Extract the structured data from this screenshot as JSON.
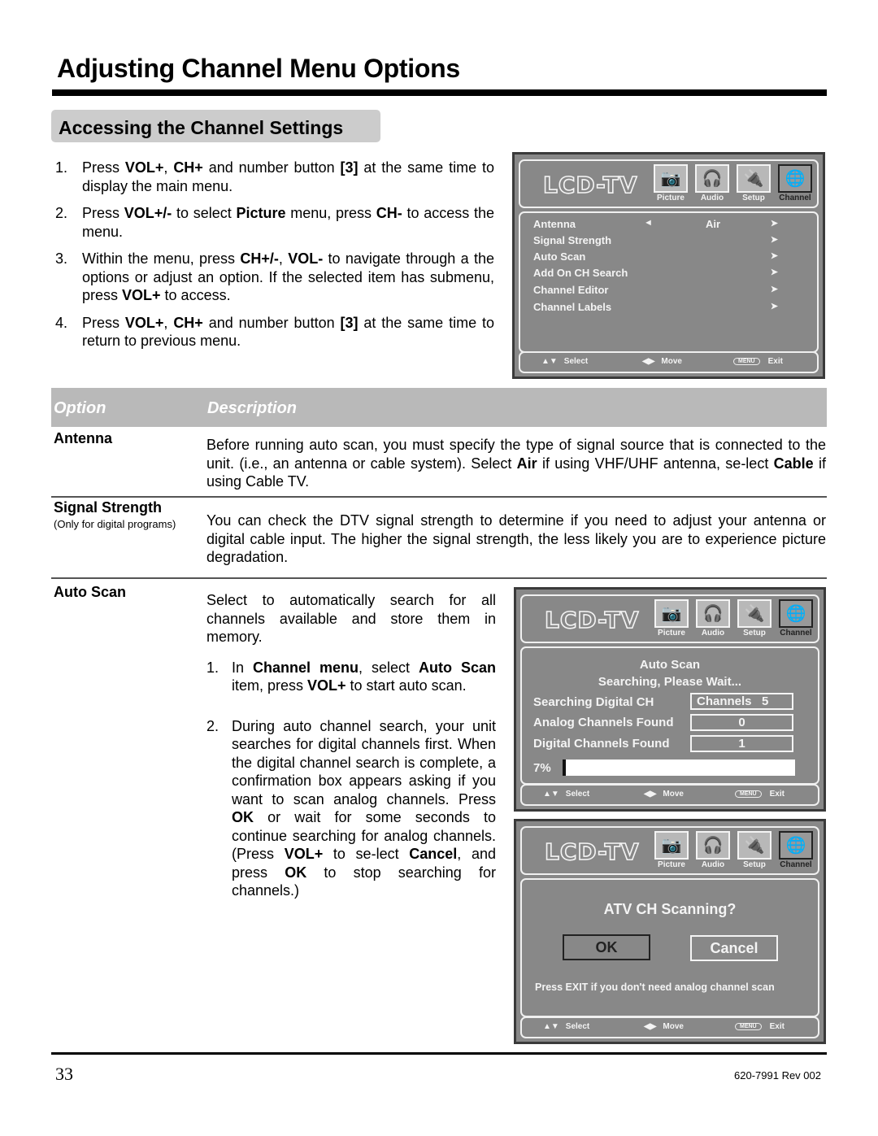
{
  "page": {
    "title": "Adjusting Channel Menu Options",
    "section_title": "Accessing the Channel Settings",
    "page_number": "33",
    "doc_id": "620-7991 Rev 002"
  },
  "steps": [
    {
      "num": "1.",
      "parts": [
        [
          "Press ",
          false
        ],
        [
          "VOL+",
          true
        ],
        [
          ", ",
          false
        ],
        [
          "CH+",
          true
        ],
        [
          " and number button ",
          false
        ],
        [
          "[3]",
          true
        ],
        [
          " at the same time to display the main menu.",
          false
        ]
      ]
    },
    {
      "num": "2.",
      "parts": [
        [
          "Press ",
          false
        ],
        [
          "VOL+/-",
          true
        ],
        [
          " to select ",
          false
        ],
        [
          "Picture",
          true
        ],
        [
          " menu, press ",
          false
        ],
        [
          "CH-",
          true
        ],
        [
          " to access the menu.",
          false
        ]
      ]
    },
    {
      "num": "3.",
      "parts": [
        [
          "Within the menu, press ",
          false
        ],
        [
          "CH+/-",
          true
        ],
        [
          ", ",
          false
        ],
        [
          "VOL-",
          true
        ],
        [
          " to navigate through a the options or adjust an option. If the selected item has submenu, press ",
          false
        ],
        [
          "VOL+",
          true
        ],
        [
          " to access.",
          false
        ]
      ]
    },
    {
      "num": "4.",
      "parts": [
        [
          "Press ",
          false
        ],
        [
          "VOL+",
          true
        ],
        [
          ", ",
          false
        ],
        [
          "CH+",
          true
        ],
        [
          " and number button ",
          false
        ],
        [
          "[3]",
          true
        ],
        [
          " at the same time to return  to previous menu.",
          false
        ]
      ]
    }
  ],
  "osd_common": {
    "logo": "LCD-TV",
    "tabs": [
      {
        "label": "Picture",
        "icon": "camera-icon",
        "glyph": "📷",
        "active": false
      },
      {
        "label": "Audio",
        "icon": "headphones-icon",
        "glyph": "🎧",
        "active": false
      },
      {
        "label": "Setup",
        "icon": "connector-icon",
        "glyph": "🔌",
        "active": false
      },
      {
        "label": "Channel",
        "icon": "globe-icon",
        "glyph": "🌐",
        "active": true
      }
    ],
    "footer": {
      "select_glyph": "▲▼",
      "select_label": "Select",
      "move_glyph": "◀▶",
      "move_label": "Move",
      "menu_key": "MENU",
      "exit_label": "Exit"
    }
  },
  "osd_channel_menu": {
    "items": [
      {
        "label": "Antenna",
        "left_arrow": "◄",
        "value": "Air",
        "right_arrow": "➤"
      },
      {
        "label": "Signal Strength",
        "left_arrow": "",
        "value": "",
        "right_arrow": "➤"
      },
      {
        "label": "Auto Scan",
        "left_arrow": "",
        "value": "",
        "right_arrow": "➤"
      },
      {
        "label": "Add On CH Search",
        "left_arrow": "",
        "value": "",
        "right_arrow": "➤"
      },
      {
        "label": "Channel Editor",
        "left_arrow": "",
        "value": "",
        "right_arrow": "➤"
      },
      {
        "label": "Channel Labels",
        "left_arrow": "",
        "value": "",
        "right_arrow": "➤"
      }
    ]
  },
  "osd_auto_scan": {
    "title": "Auto Scan",
    "subtitle": "Searching, Please Wait...",
    "rows": [
      {
        "label": "Searching Digital CH",
        "value": "Channels   5"
      },
      {
        "label": "Analog Channels Found",
        "value": "0"
      },
      {
        "label": "Digital Channels Found",
        "value": "1"
      }
    ],
    "progress_label": "7%",
    "progress": 0.07
  },
  "osd_atv": {
    "question": "ATV CH Scanning?",
    "ok_label": "OK",
    "cancel_label": "Cancel",
    "note": "Press EXIT if you don't need analog channel scan"
  },
  "options_table": {
    "header_option": "Option",
    "header_description": "Description",
    "antenna": {
      "name": "Antenna",
      "desc": [
        [
          "Before running auto scan, you must specify the type of signal source that is connected to the unit. (i.e., an antenna or cable system). Select ",
          false
        ],
        [
          "Air",
          true
        ],
        [
          " if using VHF/UHF antenna, se-lect ",
          false
        ],
        [
          "Cable",
          true
        ],
        [
          " if using Cable TV.",
          false
        ]
      ]
    },
    "signal": {
      "name": "Signal Strength",
      "note": "(Only for digital programs)",
      "desc": [
        [
          "You can check the DTV signal strength to determine if you need to adjust your antenna or digital cable input. The higher the signal strength, the less likely you are to experience picture degradation.",
          false
        ]
      ]
    },
    "autoscan": {
      "name": "Auto Scan",
      "desc": "Select to automatically search for all channels available and store them in memory.",
      "steps": [
        {
          "num": "1.",
          "parts": [
            [
              "In ",
              false
            ],
            [
              "Channel menu",
              true
            ],
            [
              ", select ",
              false
            ],
            [
              "Auto Scan",
              true
            ],
            [
              " item, press ",
              false
            ],
            [
              "VOL+",
              true
            ],
            [
              " to start auto scan.",
              false
            ]
          ]
        },
        {
          "num": "2.",
          "parts": [
            [
              "During auto channel search, your unit searches for digital channels first. When the digital channel search is complete, a confirmation box appears asking if you want to scan analog channels. Press ",
              false
            ],
            [
              "OK",
              true
            ],
            [
              " or wait for some seconds to continue searching for analog channels. (Press ",
              false
            ],
            [
              "VOL+",
              true
            ],
            [
              " to se-lect ",
              false
            ],
            [
              "Cancel",
              true
            ],
            [
              ", and press ",
              false
            ],
            [
              "OK",
              true
            ],
            [
              " to stop searching for channels.)",
              false
            ]
          ]
        }
      ]
    }
  }
}
